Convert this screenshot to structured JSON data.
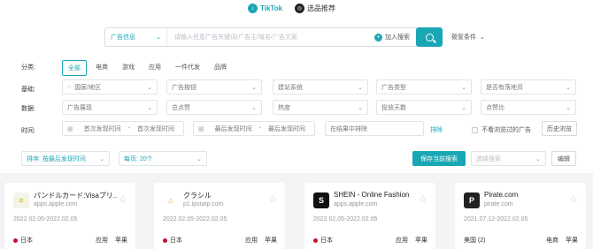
{
  "brand": {
    "tiktok": "TikTok",
    "products": "选品推荐"
  },
  "search": {
    "type": "广告信息",
    "placeholder": "请输入任意广告关键词/广告主/域名/广告文案",
    "join": "加入搜索",
    "advanced": "筱筐条件"
  },
  "filters": {
    "category_label": "分类:",
    "categories": [
      "全部",
      "电商",
      "游戏",
      "应用",
      "一件代发",
      "品牌"
    ],
    "basic_label": "基础:",
    "basic": [
      "国家/地区",
      "广告按钮",
      "建站系统",
      "广告类型",
      "是否有落地页"
    ],
    "data_label": "数据:",
    "data": [
      "广告展现",
      "总点赞",
      "热度",
      "投放天数",
      "点赞比"
    ],
    "time_label": "时间:",
    "first_start": "首次发现时间",
    "first_end": "首次发现时间",
    "last_start": "最后发现时间",
    "last_end": "最后发现时间",
    "exclude": "在结果中排除",
    "exclude_btn": "排除",
    "not_browsed": "不看浏览过的广告",
    "history": "历史浏览"
  },
  "toolbar": {
    "sort": "排序: 按最后发现时间",
    "page_size": "每页: 20个",
    "save": "保存当前搜索",
    "choose_search": "选择搜索",
    "edit": "编辑"
  },
  "cards": [
    {
      "title": "パンドルカード:Visaプリ...",
      "domain": "apps.apple.com",
      "date": "2022.02.05-2022.02.05",
      "country": "日本",
      "tag": "应用",
      "platform": "苹果",
      "logo": "≡",
      "logo_bg": "#f2f4e8",
      "logo_color": "#d7b400"
    },
    {
      "title": "クラシル",
      "domain": "p1.ipstatp.com",
      "date": "2022.02.05-2022.02.05",
      "country": "日本",
      "tag": "应用",
      "platform": "苹果",
      "logo": "⌂",
      "logo_bg": "#ffffff",
      "logo_color": "#f2a23a"
    },
    {
      "title": "SHEIN - Online Fashion",
      "domain": "apps.apple.com",
      "date": "2022.02.05-2022.02.05",
      "country": "日本",
      "tag": "应用",
      "platform": "苹果",
      "logo": "S",
      "logo_bg": "#111111",
      "logo_color": "#ffffff"
    },
    {
      "title": "Pirate.com",
      "domain": "pirate.com",
      "date": "2021.07.12-2022.02.05",
      "country": "美国 (2)",
      "tag": "电商",
      "platform": "苹果",
      "logo": "P",
      "logo_bg": "#222222",
      "logo_color": "#ffffff"
    }
  ],
  "colors": {
    "accent": "#1aa7b5"
  }
}
